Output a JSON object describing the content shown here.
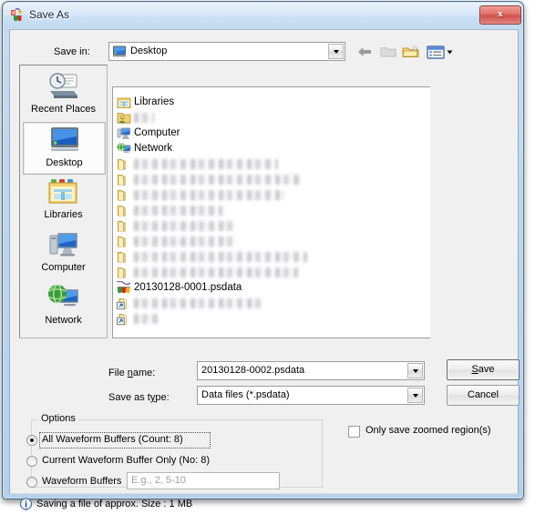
{
  "window": {
    "title": "Save As",
    "app_icon": "waveform-icon",
    "close_label": "x",
    "accent_close": "#cf4f49",
    "frame_color": "#b4d1ec"
  },
  "savein": {
    "label": "Save in:",
    "value": "Desktop",
    "icon": "desktop-icon"
  },
  "toolbar": {
    "buttons": [
      {
        "name": "back-button",
        "icon": "back-arrow-icon",
        "enabled": false
      },
      {
        "name": "up-folder-button",
        "icon": "up-folder-icon",
        "enabled": false
      },
      {
        "name": "new-folder-button",
        "icon": "new-folder-icon",
        "enabled": true
      },
      {
        "name": "views-button",
        "icon": "views-icon",
        "enabled": true
      }
    ]
  },
  "places": [
    {
      "label": "Recent Places",
      "icon": "recent-places-icon",
      "selected": false
    },
    {
      "label": "Desktop",
      "icon": "desktop-icon",
      "selected": true
    },
    {
      "label": "Libraries",
      "icon": "libraries-icon",
      "selected": false
    },
    {
      "label": "Computer",
      "icon": "computer-icon",
      "selected": false
    },
    {
      "label": "Network",
      "icon": "network-icon",
      "selected": false
    }
  ],
  "file_list": [
    {
      "name": "Libraries",
      "icon": "libraries-icon",
      "blurred": false
    },
    {
      "name": "",
      "icon": "user-folder-icon",
      "blurred": true,
      "blur_width": 22
    },
    {
      "name": "Computer",
      "icon": "computer-icon",
      "blurred": false
    },
    {
      "name": "Network",
      "icon": "network-icon",
      "blurred": false
    },
    {
      "name": "",
      "icon": "folder-icon",
      "blurred": true,
      "blur_width": 158
    },
    {
      "name": "",
      "icon": "folder-icon",
      "blurred": true,
      "blur_width": 183
    },
    {
      "name": "",
      "icon": "folder-icon",
      "blurred": true,
      "blur_width": 165
    },
    {
      "name": "",
      "icon": "folder-icon",
      "blurred": true,
      "blur_width": 97
    },
    {
      "name": "",
      "icon": "folder-icon",
      "blurred": true,
      "blur_width": 110
    },
    {
      "name": "",
      "icon": "folder-icon",
      "blurred": true,
      "blur_width": 113
    },
    {
      "name": "",
      "icon": "folder-icon",
      "blurred": true,
      "blur_width": 190
    },
    {
      "name": "",
      "icon": "folder-icon",
      "blurred": true,
      "blur_width": 180
    },
    {
      "name": "20130128-0001.psdata",
      "icon": "psdata-file-icon",
      "blurred": false
    },
    {
      "name": "",
      "icon": "shortcut-icon",
      "blurred": true,
      "blur_width": 143
    },
    {
      "name": "",
      "icon": "shortcut-icon",
      "blurred": true,
      "blur_width": 30
    }
  ],
  "filename": {
    "label": "File name:",
    "label_prefix": "File ",
    "label_accel": "n",
    "label_suffix": "ame:",
    "value": "20130128-0002.psdata"
  },
  "filetype": {
    "label": "Save as type:",
    "label_prefix": "Save as t",
    "label_accel": "y",
    "label_suffix": "pe:",
    "value": "Data files (*.psdata)"
  },
  "buttons": {
    "save": {
      "prefix": "",
      "accel": "S",
      "suffix": "ave",
      "full": "Save"
    },
    "cancel": {
      "full": "Cancel"
    }
  },
  "options": {
    "legend": "Options",
    "radios": [
      {
        "label": "All Waveform Buffers (Count: 8)",
        "checked": true,
        "focused": true
      },
      {
        "label": "Current Waveform Buffer Only (No: 8)",
        "checked": false,
        "focused": false
      },
      {
        "label": "Waveform Buffers",
        "checked": false,
        "focused": false
      }
    ],
    "buffer_input_placeholder": "E.g., 2, 5-10",
    "buffer_input_value": ""
  },
  "zoom_checkbox": {
    "label": "Only save zoomed region(s)",
    "checked": false
  },
  "status": {
    "icon": "info-icon",
    "text": "Saving a file of approx. Size : 1 MB"
  }
}
